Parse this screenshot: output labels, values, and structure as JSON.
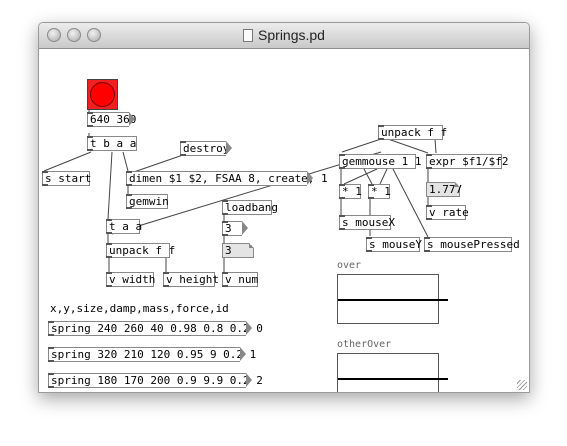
{
  "window": {
    "title": "Springs.pd"
  },
  "objects": {
    "dims_msg": "640 360",
    "tbaa": "t b a a",
    "destroy": "destroy",
    "s_start": "s start",
    "dimen": "dimen $1 $2, FSAA 8, create, 1",
    "gemwin": "gemwin",
    "loadbang": "loadbang",
    "num3a": "3",
    "num3b": "3",
    "taa": "t a a",
    "unpack_ff_left": "unpack f f",
    "v_width": "v width",
    "v_height": "v height",
    "v_num": "v num",
    "unpack_ff_right": "unpack f f",
    "gemmouse": "gemmouse 1 1",
    "expr": "expr $f1/$f2",
    "mult1": "* 1",
    "mult2": "* 1",
    "rate_atom": "1.777",
    "s_mouseX": "s mouseX",
    "v_rate": "v rate",
    "s_mouseY": "s mouseY",
    "s_mousePressed": "s mousePressed",
    "comment_params": "x,y,size,damp,mass,force,id",
    "spring1": "spring 240 260 40 0.98 0.8 0.2 0",
    "spring2": "spring 320 210 120 0.95 9 0.2 1",
    "spring3": "spring 180 170 200 0.9 9.9 0.2 2"
  },
  "graphs": {
    "over": "over",
    "otherOver": "otherOver"
  },
  "colors": {
    "bang": "#ff0000",
    "window_bg": "#ffffff"
  }
}
